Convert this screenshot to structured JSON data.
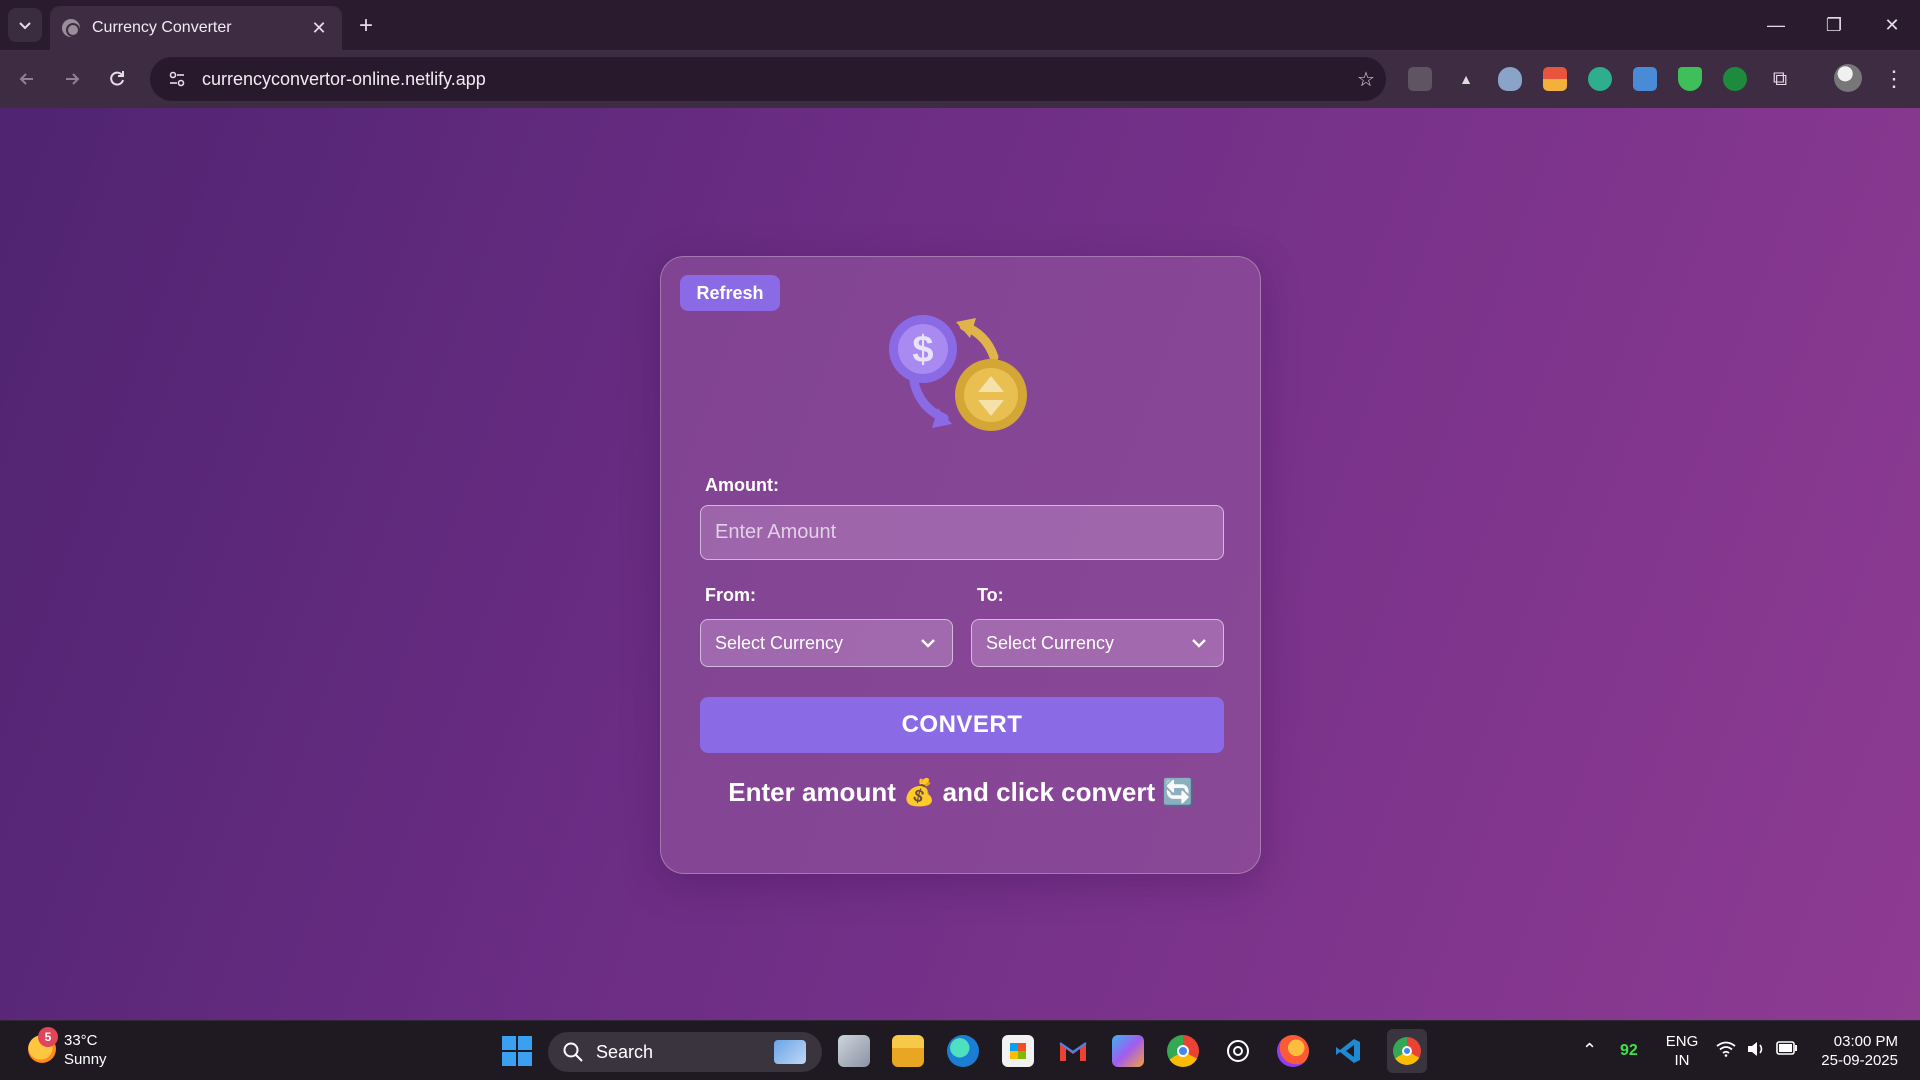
{
  "browser": {
    "tab_title": "Currency Converter",
    "url": "currencyconvertor-online.netlify.app"
  },
  "app": {
    "refresh_label": "Refresh",
    "amount_label": "Amount:",
    "amount_placeholder": "Enter Amount",
    "from_label": "From:",
    "to_label": "To:",
    "from_value": "Select Currency",
    "to_value": "Select Currency",
    "convert_label": "CONVERT",
    "message": "Enter amount 💰 and click convert 🔄",
    "colors": {
      "accent": "#8b6ae6",
      "background_start": "#4f2470",
      "background_end": "#8e3b92"
    }
  },
  "taskbar": {
    "weather_badge": "5",
    "temperature": "33°C",
    "condition": "Sunny",
    "search_label": "Search",
    "battery_count": "92",
    "lang_line1": "ENG",
    "lang_line2": "IN",
    "time": "03:00 PM",
    "date": "25-09-2025"
  }
}
